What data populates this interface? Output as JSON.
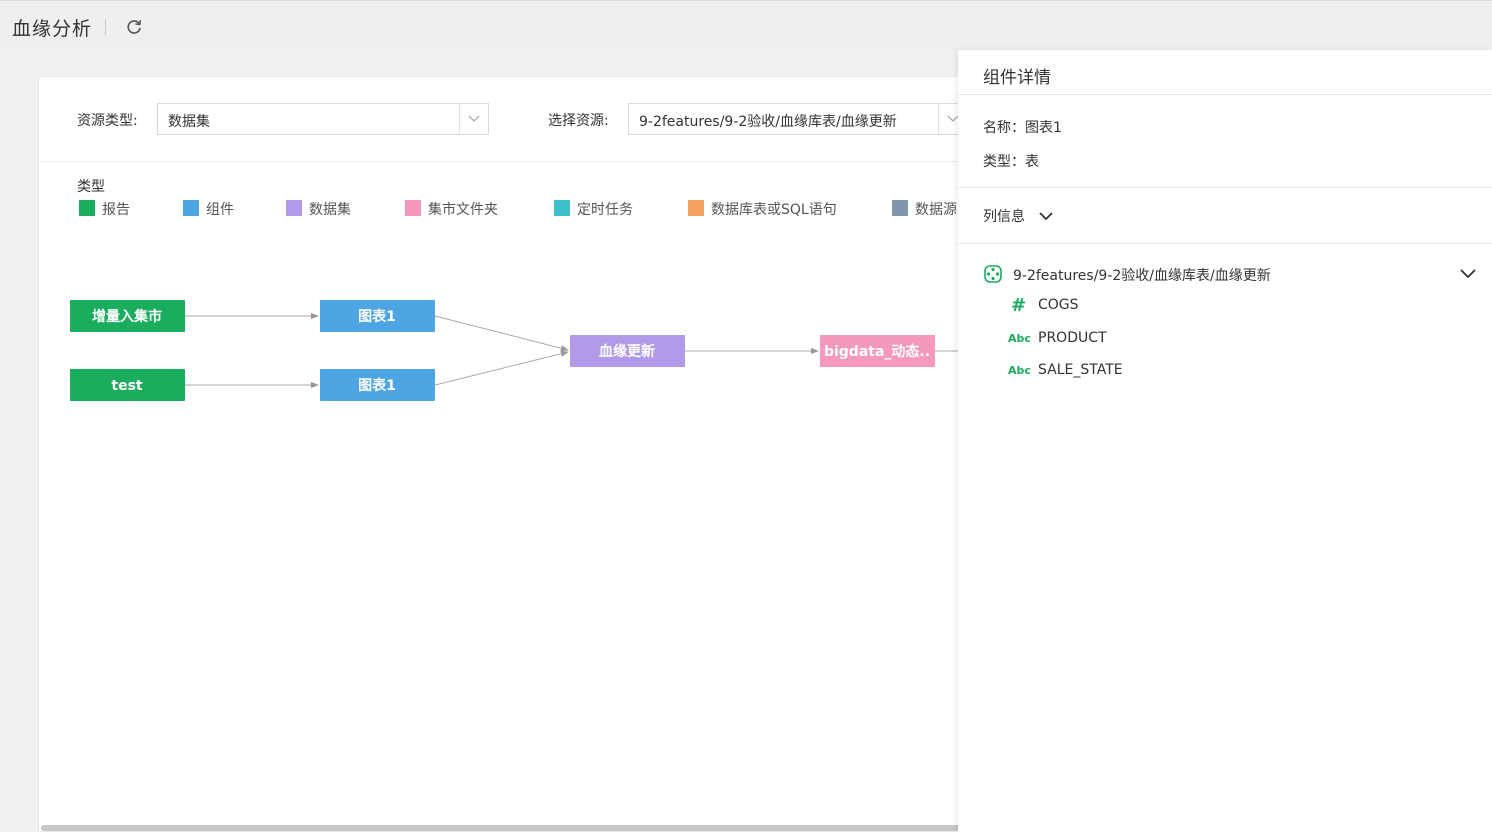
{
  "header": {
    "title": "血缘分析"
  },
  "filters": {
    "resource_type_label": "资源类型:",
    "resource_type_value": "数据集",
    "select_resource_label": "选择资源:",
    "select_resource_value": "9-2features/9-2验收/血缘库表/血缘更新"
  },
  "legend": {
    "title": "类型",
    "items": [
      {
        "label": "报告",
        "color": "#1aad5d"
      },
      {
        "label": "组件",
        "color": "#4ea5e3"
      },
      {
        "label": "数据集",
        "color": "#b19be8"
      },
      {
        "label": "集市文件夹",
        "color": "#f598be"
      },
      {
        "label": "定时任务",
        "color": "#3cc1c8"
      },
      {
        "label": "数据库表或SQL语句",
        "color": "#f5a05c"
      },
      {
        "label": "数据源",
        "color": "#8096ad"
      }
    ]
  },
  "graph": {
    "nodes": [
      {
        "label": "增量入集市",
        "color": "#1aad5d"
      },
      {
        "label": "test",
        "color": "#1aad5d"
      },
      {
        "label": "图表1",
        "color": "#4ea5e3"
      },
      {
        "label": "图表1",
        "color": "#4ea5e3"
      },
      {
        "label": "血缘更新",
        "color": "#b19be8"
      },
      {
        "label": "bigdata_动态..",
        "color": "#f598be"
      }
    ]
  },
  "detail": {
    "title": "组件详情",
    "name": "名称：图表1",
    "type": "类型：表",
    "column_info_label": "列信息",
    "dataset_path": "9-2features/9-2验收/血缘库表/血缘更新",
    "columns": [
      {
        "type_symbol": "#",
        "name": "COGS"
      },
      {
        "type_symbol": "Abc",
        "name": "PRODUCT"
      },
      {
        "type_symbol": "Abc",
        "name": "SALE_STATE"
      }
    ]
  }
}
